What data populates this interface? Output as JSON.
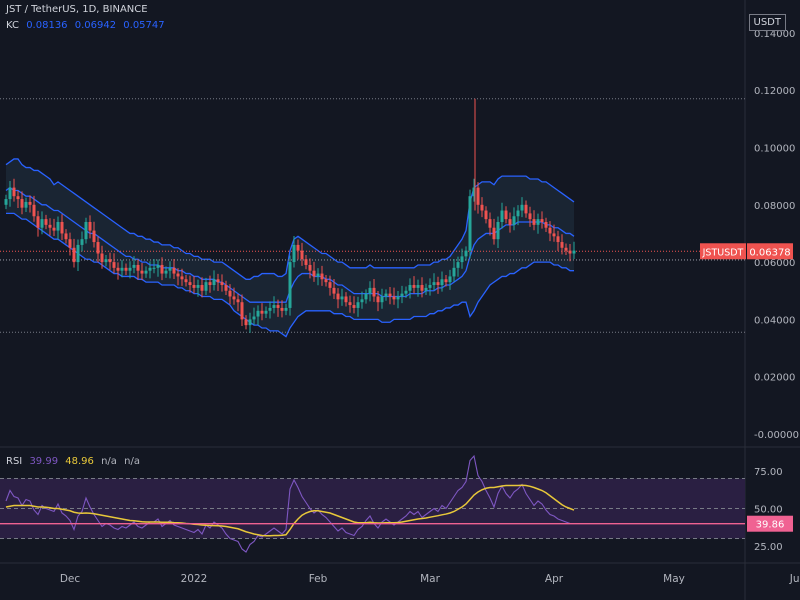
{
  "header": {
    "symbol_line": "JST / TetherUS, 1D, BINANCE",
    "kc_label": "KC",
    "kc_values": [
      "0.08136",
      "0.06942",
      "0.05747"
    ]
  },
  "currency_button": "USDT",
  "price_axis": {
    "ticks": [
      "0.14000",
      "0.12000",
      "0.10000",
      "0.08000",
      "0.06000",
      "0.04000",
      "0.02000",
      "-0.00000"
    ],
    "tick_values": [
      0.14,
      0.12,
      0.1,
      0.08,
      0.06,
      0.04,
      0.02,
      0.0
    ]
  },
  "price_label": {
    "symbol": "JSTUSDT",
    "value": "0.06378",
    "price": 0.06378
  },
  "rsi": {
    "label": "RSI",
    "value": "39.99",
    "ma_value": "48.96",
    "na1": "n/a",
    "na2": "n/a",
    "ticks": [
      "75.00",
      "50.00",
      "25.00"
    ],
    "tick_values": [
      75,
      50,
      25
    ],
    "current_label": "39.86",
    "current_value": 39.86,
    "upper_band": 70,
    "middle_band": 50,
    "lower_band": 30
  },
  "time_axis": {
    "labels": [
      "Dec",
      "2022",
      "Feb",
      "Mar",
      "Apr",
      "May",
      "Jun"
    ],
    "label_days": [
      16,
      47,
      78,
      106,
      137,
      167,
      198
    ]
  },
  "colors": {
    "bg": "#131722",
    "up": "#26a69a",
    "down": "#ef5350",
    "kc": "#2962ff",
    "kc_fill": "#1c2836",
    "rsi": "#7e57c2",
    "rsi_ma": "#e8c83a",
    "rsi_band": "#2a1f42",
    "grid": "#2a2e39"
  },
  "chart_data": {
    "type": "candlestick",
    "title": "JST / TetherUS, 1D, BINANCE",
    "x_start": "2021-11-15",
    "ylim": [
      0,
      0.14
    ],
    "horizontal_lines": [
      0.117,
      0.0607,
      0.0608,
      0.0355
    ],
    "price_series": [
      0.082,
      0.086,
      0.083,
      0.082,
      0.079,
      0.081,
      0.08,
      0.076,
      0.072,
      0.075,
      0.073,
      0.072,
      0.071,
      0.074,
      0.07,
      0.068,
      0.065,
      0.06,
      0.066,
      0.068,
      0.074,
      0.071,
      0.067,
      0.063,
      0.06,
      0.061,
      0.06,
      0.058,
      0.057,
      0.058,
      0.057,
      0.058,
      0.059,
      0.057,
      0.056,
      0.057,
      0.058,
      0.058,
      0.059,
      0.056,
      0.057,
      0.058,
      0.056,
      0.055,
      0.054,
      0.053,
      0.052,
      0.051,
      0.052,
      0.05,
      0.053,
      0.052,
      0.054,
      0.053,
      0.052,
      0.05,
      0.048,
      0.047,
      0.046,
      0.04,
      0.038,
      0.04,
      0.041,
      0.043,
      0.042,
      0.043,
      0.044,
      0.045,
      0.044,
      0.043,
      0.044,
      0.06,
      0.066,
      0.064,
      0.061,
      0.059,
      0.057,
      0.055,
      0.056,
      0.054,
      0.053,
      0.051,
      0.049,
      0.047,
      0.048,
      0.046,
      0.045,
      0.044,
      0.046,
      0.047,
      0.049,
      0.051,
      0.048,
      0.046,
      0.048,
      0.049,
      0.048,
      0.047,
      0.048,
      0.049,
      0.05,
      0.052,
      0.051,
      0.052,
      0.05,
      0.051,
      0.052,
      0.053,
      0.052,
      0.054,
      0.053,
      0.055,
      0.058,
      0.06,
      0.062,
      0.064,
      0.083,
      0.086,
      0.08,
      0.078,
      0.075,
      0.072,
      0.068,
      0.074,
      0.078,
      0.075,
      0.073,
      0.076,
      0.078,
      0.08,
      0.077,
      0.075,
      0.073,
      0.075,
      0.074,
      0.072,
      0.07,
      0.069,
      0.067,
      0.065,
      0.064,
      0.063,
      0.064
    ],
    "kc": {
      "upper": [
        0.094,
        0.095,
        0.096,
        0.096,
        0.094,
        0.093,
        0.093,
        0.092,
        0.092,
        0.091,
        0.09,
        0.089,
        0.087,
        0.088,
        0.087,
        0.086,
        0.085,
        0.084,
        0.083,
        0.082,
        0.081,
        0.08,
        0.079,
        0.078,
        0.077,
        0.076,
        0.075,
        0.074,
        0.073,
        0.072,
        0.071,
        0.07,
        0.07,
        0.069,
        0.069,
        0.068,
        0.068,
        0.067,
        0.067,
        0.066,
        0.066,
        0.066,
        0.065,
        0.065,
        0.064,
        0.063,
        0.063,
        0.062,
        0.062,
        0.061,
        0.061,
        0.061,
        0.06,
        0.06,
        0.06,
        0.059,
        0.058,
        0.057,
        0.056,
        0.055,
        0.054,
        0.054,
        0.055,
        0.055,
        0.056,
        0.056,
        0.056,
        0.056,
        0.055,
        0.055,
        0.056,
        0.064,
        0.068,
        0.069,
        0.068,
        0.067,
        0.066,
        0.065,
        0.064,
        0.063,
        0.063,
        0.062,
        0.061,
        0.06,
        0.06,
        0.059,
        0.058,
        0.058,
        0.058,
        0.058,
        0.058,
        0.059,
        0.058,
        0.058,
        0.058,
        0.058,
        0.058,
        0.058,
        0.058,
        0.058,
        0.058,
        0.058,
        0.058,
        0.059,
        0.059,
        0.059,
        0.059,
        0.06,
        0.06,
        0.061,
        0.061,
        0.062,
        0.064,
        0.066,
        0.068,
        0.071,
        0.081,
        0.086,
        0.087,
        0.088,
        0.088,
        0.088,
        0.087,
        0.089,
        0.09,
        0.09,
        0.09,
        0.09,
        0.09,
        0.09,
        0.09,
        0.089,
        0.089,
        0.089,
        0.088,
        0.088,
        0.087,
        0.086,
        0.085,
        0.084,
        0.083,
        0.082,
        0.081
      ],
      "middle": [
        0.085,
        0.086,
        0.085,
        0.085,
        0.084,
        0.083,
        0.083,
        0.082,
        0.081,
        0.08,
        0.08,
        0.079,
        0.078,
        0.078,
        0.077,
        0.076,
        0.075,
        0.074,
        0.073,
        0.072,
        0.071,
        0.07,
        0.07,
        0.069,
        0.068,
        0.067,
        0.066,
        0.065,
        0.064,
        0.063,
        0.062,
        0.062,
        0.061,
        0.061,
        0.06,
        0.06,
        0.059,
        0.059,
        0.059,
        0.058,
        0.058,
        0.058,
        0.058,
        0.057,
        0.057,
        0.056,
        0.056,
        0.055,
        0.055,
        0.054,
        0.054,
        0.054,
        0.054,
        0.053,
        0.053,
        0.052,
        0.051,
        0.05,
        0.049,
        0.048,
        0.047,
        0.046,
        0.046,
        0.046,
        0.046,
        0.046,
        0.046,
        0.046,
        0.046,
        0.046,
        0.046,
        0.05,
        0.053,
        0.055,
        0.056,
        0.056,
        0.056,
        0.055,
        0.055,
        0.055,
        0.054,
        0.054,
        0.053,
        0.052,
        0.052,
        0.051,
        0.05,
        0.049,
        0.049,
        0.049,
        0.049,
        0.049,
        0.049,
        0.049,
        0.048,
        0.048,
        0.048,
        0.048,
        0.048,
        0.048,
        0.048,
        0.049,
        0.049,
        0.049,
        0.049,
        0.05,
        0.05,
        0.05,
        0.051,
        0.051,
        0.052,
        0.052,
        0.053,
        0.054,
        0.055,
        0.057,
        0.062,
        0.066,
        0.068,
        0.069,
        0.07,
        0.07,
        0.07,
        0.071,
        0.072,
        0.073,
        0.073,
        0.073,
        0.074,
        0.074,
        0.074,
        0.074,
        0.074,
        0.074,
        0.074,
        0.073,
        0.073,
        0.072,
        0.072,
        0.071,
        0.07,
        0.07,
        0.069
      ],
      "lower": [
        0.077,
        0.077,
        0.077,
        0.076,
        0.075,
        0.075,
        0.074,
        0.073,
        0.072,
        0.071,
        0.07,
        0.069,
        0.068,
        0.068,
        0.067,
        0.066,
        0.065,
        0.064,
        0.063,
        0.062,
        0.061,
        0.061,
        0.06,
        0.06,
        0.059,
        0.058,
        0.057,
        0.056,
        0.056,
        0.055,
        0.055,
        0.055,
        0.055,
        0.054,
        0.054,
        0.053,
        0.053,
        0.053,
        0.053,
        0.052,
        0.052,
        0.052,
        0.052,
        0.051,
        0.051,
        0.05,
        0.05,
        0.049,
        0.049,
        0.048,
        0.048,
        0.048,
        0.047,
        0.047,
        0.047,
        0.046,
        0.045,
        0.043,
        0.042,
        0.041,
        0.04,
        0.039,
        0.038,
        0.038,
        0.037,
        0.037,
        0.036,
        0.036,
        0.036,
        0.035,
        0.034,
        0.037,
        0.039,
        0.041,
        0.042,
        0.043,
        0.043,
        0.043,
        0.043,
        0.043,
        0.043,
        0.043,
        0.042,
        0.042,
        0.042,
        0.041,
        0.041,
        0.04,
        0.04,
        0.04,
        0.04,
        0.04,
        0.04,
        0.04,
        0.039,
        0.039,
        0.039,
        0.04,
        0.04,
        0.04,
        0.04,
        0.04,
        0.041,
        0.041,
        0.041,
        0.041,
        0.042,
        0.042,
        0.043,
        0.043,
        0.044,
        0.044,
        0.045,
        0.045,
        0.046,
        0.046,
        0.041,
        0.043,
        0.046,
        0.048,
        0.05,
        0.052,
        0.053,
        0.054,
        0.055,
        0.055,
        0.056,
        0.056,
        0.057,
        0.058,
        0.058,
        0.059,
        0.06,
        0.06,
        0.06,
        0.06,
        0.06,
        0.059,
        0.059,
        0.058,
        0.058,
        0.057,
        0.057
      ]
    },
    "rsi_series": [
      55,
      62,
      58,
      57,
      52,
      56,
      55,
      49,
      46,
      52,
      50,
      49,
      48,
      53,
      47,
      45,
      42,
      36,
      45,
      48,
      57,
      51,
      46,
      42,
      38,
      40,
      39,
      37,
      36,
      38,
      37,
      39,
      41,
      38,
      37,
      39,
      41,
      41,
      43,
      38,
      40,
      42,
      39,
      38,
      37,
      36,
      35,
      34,
      36,
      33,
      39,
      37,
      41,
      39,
      37,
      33,
      30,
      29,
      28,
      23,
      21,
      26,
      28,
      32,
      31,
      33,
      35,
      37,
      35,
      33,
      36,
      63,
      69,
      64,
      58,
      54,
      50,
      47,
      49,
      46,
      44,
      41,
      38,
      35,
      37,
      34,
      33,
      32,
      36,
      38,
      42,
      45,
      40,
      37,
      41,
      43,
      41,
      39,
      41,
      43,
      45,
      48,
      46,
      48,
      44,
      46,
      48,
      50,
      48,
      52,
      50,
      54,
      58,
      62,
      64,
      68,
      82,
      85,
      72,
      68,
      62,
      57,
      51,
      60,
      65,
      60,
      57,
      61,
      63,
      66,
      60,
      56,
      52,
      55,
      53,
      49,
      46,
      45,
      43,
      42,
      41,
      40,
      40
    ],
    "rsi_ma_series": [
      51,
      51.5,
      52,
      52,
      52,
      52,
      52,
      51.5,
      51,
      51,
      50.8,
      50.5,
      50,
      50,
      49.5,
      49,
      48.5,
      47.5,
      47,
      46.8,
      47,
      46.8,
      46.5,
      46,
      45.5,
      45,
      44.5,
      44,
      43.5,
      43,
      42.5,
      42,
      41.8,
      41.5,
      41.2,
      41,
      41,
      41,
      41,
      40.8,
      40.8,
      40.8,
      40.6,
      40.5,
      40.3,
      40,
      39.8,
      39.5,
      39.3,
      39,
      38.8,
      38.7,
      38.6,
      38.5,
      38.3,
      38,
      37.5,
      37,
      36.5,
      35.5,
      34.5,
      33.8,
      33,
      32.5,
      32,
      31.8,
      31.8,
      32,
      32,
      32.2,
      32.5,
      36,
      40,
      43,
      45.5,
      47,
      48,
      48.5,
      48.5,
      48,
      47.5,
      47,
      46,
      45,
      44,
      43,
      42,
      41,
      40.5,
      40.5,
      40.5,
      40.8,
      40.5,
      40.3,
      40.3,
      40.5,
      40.5,
      40.5,
      40.7,
      41,
      41.5,
      42,
      42.5,
      43,
      43.3,
      43.7,
      44.2,
      44.7,
      45.2,
      45.8,
      46.3,
      47,
      48,
      49.5,
      51,
      53,
      56,
      59,
      61,
      62.5,
      63.5,
      64,
      64,
      64.5,
      65,
      65.3,
      65.3,
      65.3,
      65.3,
      65.5,
      65.3,
      64.8,
      64,
      63,
      62,
      60.5,
      58.5,
      56.5,
      54.5,
      52.5,
      51,
      50,
      48.96
    ]
  }
}
